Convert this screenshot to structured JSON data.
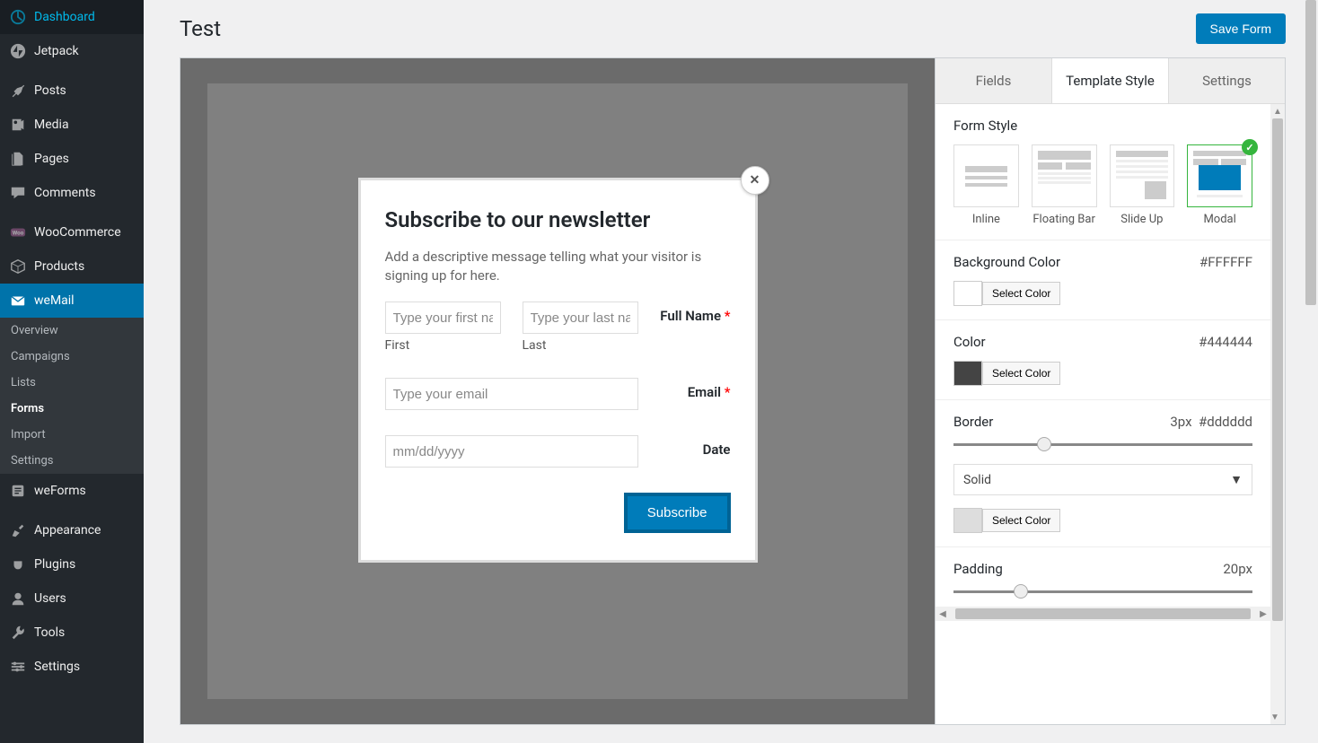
{
  "sidebar": {
    "items": [
      {
        "label": "Dashboard",
        "icon": "dashboard"
      },
      {
        "label": "Jetpack",
        "icon": "jetpack"
      }
    ],
    "items2": [
      {
        "label": "Posts",
        "icon": "pin"
      },
      {
        "label": "Media",
        "icon": "media"
      },
      {
        "label": "Pages",
        "icon": "pages"
      },
      {
        "label": "Comments",
        "icon": "comment"
      }
    ],
    "items3": [
      {
        "label": "WooCommerce",
        "icon": "woo"
      },
      {
        "label": "Products",
        "icon": "products"
      },
      {
        "label": "weMail",
        "icon": "wemail",
        "active": true
      }
    ],
    "sub": [
      {
        "label": "Overview"
      },
      {
        "label": "Campaigns"
      },
      {
        "label": "Lists"
      },
      {
        "label": "Forms",
        "active": true
      },
      {
        "label": "Import"
      },
      {
        "label": "Settings"
      }
    ],
    "items4": [
      {
        "label": "weForms",
        "icon": "weforms"
      }
    ],
    "items5": [
      {
        "label": "Appearance",
        "icon": "appearance"
      },
      {
        "label": "Plugins",
        "icon": "plugins"
      },
      {
        "label": "Users",
        "icon": "users"
      },
      {
        "label": "Tools",
        "icon": "tools"
      },
      {
        "label": "Settings",
        "icon": "settings"
      }
    ]
  },
  "page": {
    "title": "Test",
    "save": "Save Form"
  },
  "modal": {
    "title": "Subscribe to our newsletter",
    "desc": "Add a descriptive message telling what your visitor is signing up for here.",
    "first_ph": "Type your first name",
    "last_ph": "Type your last name",
    "first_sub": "First",
    "last_sub": "Last",
    "fullname_label": "Full Name",
    "email_ph": "Type your email",
    "email_label": "Email",
    "date_ph": "mm/dd/yyyy",
    "date_label": "Date",
    "submit": "Subscribe",
    "close": "✕"
  },
  "panel": {
    "tabs": [
      "Fields",
      "Template Style",
      "Settings"
    ],
    "active_tab": 1,
    "form_style": {
      "title": "Form Style",
      "options": [
        {
          "label": "Inline"
        },
        {
          "label": "Floating Bar"
        },
        {
          "label": "Slide Up"
        },
        {
          "label": "Modal",
          "selected": true
        }
      ]
    },
    "bg_color": {
      "title": "Background Color",
      "value": "#FFFFFF",
      "btn": "Select Color"
    },
    "color": {
      "title": "Color",
      "value": "#444444",
      "btn": "Select Color"
    },
    "border": {
      "title": "Border",
      "px": "3px",
      "hex": "#dddddd",
      "style": "Solid",
      "btn": "Select Color"
    },
    "padding": {
      "title": "Padding",
      "value": "20px"
    }
  }
}
